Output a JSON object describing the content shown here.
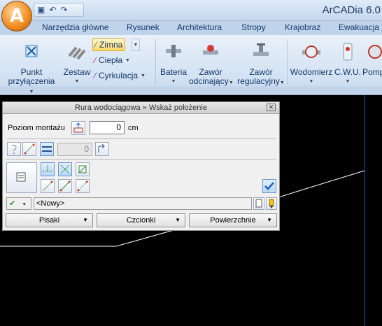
{
  "app": {
    "title": "ArCADia 6.0"
  },
  "tabs": [
    "Narzędzia główne",
    "Rysunek",
    "Architektura",
    "Stropy",
    "Krajobraz",
    "Ewakuacja"
  ],
  "ribbon": {
    "punkt": [
      "Punkt",
      "przyłączenia"
    ],
    "zestaw": "Zestaw",
    "zimna": "Zimna",
    "ciepla": "Ciepła",
    "cyrkulacja": "Cyrkulacja",
    "bateria": "Bateria",
    "zawor_odc": [
      "Zawór",
      "odcinający"
    ],
    "zawor_reg": [
      "Zawór",
      "regulacyjny"
    ],
    "wodomierz": "Wodomierz",
    "cwu": "C.W.U.",
    "pomp": "Pomp"
  },
  "dialog": {
    "title": "Rura wodociągowa » Wskaż położenie",
    "poziom_label": "Poziom montażu",
    "poziom_value": "0",
    "poziom_unit": "cm",
    "disabled_value": "0",
    "layer_value": "<Nowy>",
    "buttons": {
      "pisaki": "Pisaki",
      "czcionki": "Czcionki",
      "powierzchnie": "Powierzchnie"
    }
  },
  "colors": {
    "accent_blue": "#1f5fbf",
    "canvas": "#000000",
    "line": "#ffffff"
  }
}
